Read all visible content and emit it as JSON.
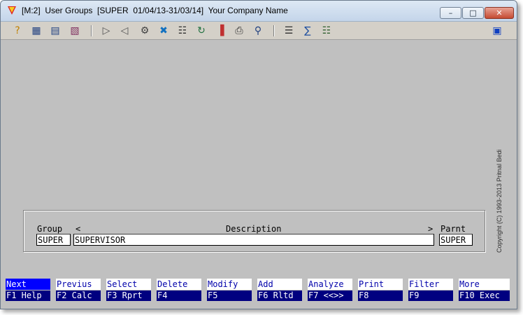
{
  "window": {
    "title": "[M:2]  User Groups  [SUPER  01/04/13-31/03/14]  Your Company Name",
    "buttons": {
      "minimize": "–",
      "maximize": "□",
      "close": "✕"
    }
  },
  "toolbar": {
    "icons": [
      {
        "name": "help-icon",
        "glyph": "?"
      },
      {
        "name": "grid-icon",
        "glyph": "▦"
      },
      {
        "name": "table-icon",
        "glyph": "▤"
      },
      {
        "name": "chart-icon",
        "glyph": "▧"
      },
      {
        "name": "play-next-icon",
        "glyph": "▷"
      },
      {
        "name": "play-prev-icon",
        "glyph": "◁"
      },
      {
        "name": "settings-icon",
        "glyph": "⚙"
      },
      {
        "name": "tools-icon",
        "glyph": "✖"
      },
      {
        "name": "document-icon",
        "glyph": "☷"
      },
      {
        "name": "sync-icon",
        "glyph": "↻"
      },
      {
        "name": "bar-chart-icon",
        "glyph": "▐"
      },
      {
        "name": "printer-icon",
        "glyph": "⎙"
      },
      {
        "name": "search-icon",
        "glyph": "⚲"
      },
      {
        "name": "clipboard-icon",
        "glyph": "☰"
      },
      {
        "name": "calculator-icon",
        "glyph": "∑"
      },
      {
        "name": "network-icon",
        "glyph": "☷"
      },
      {
        "name": "exit-icon",
        "glyph": "▣"
      }
    ]
  },
  "copyright": "Copyright (C) 1993-2013 Pritnal Bedi",
  "form": {
    "headers": {
      "group": "Group",
      "lt": "<",
      "description": "Description",
      "gt": ">",
      "parent": "Parnt"
    },
    "values": {
      "group": "SUPER",
      "description": "SUPERVISOR",
      "parent": "SUPER"
    }
  },
  "fkeys": [
    {
      "top": "Next",
      "bottom": "F1 Help"
    },
    {
      "top": "Previus",
      "bottom": "F2 Calc"
    },
    {
      "top": "Select",
      "bottom": "F3 Rprt"
    },
    {
      "top": "Delete",
      "bottom": "F4"
    },
    {
      "top": "Modify",
      "bottom": "F5"
    },
    {
      "top": "Add",
      "bottom": "F6 Rltd"
    },
    {
      "top": "Analyze",
      "bottom": "F7 <<>>"
    },
    {
      "top": "Print",
      "bottom": "F8"
    },
    {
      "top": "Filter",
      "bottom": "F9"
    },
    {
      "top": "More",
      "bottom": "F10 Exec"
    }
  ],
  "colors": {
    "background": "#c0c0c0",
    "fkey_bottom": "#000080",
    "fkey_active": "#0000ff",
    "fkey_text": "#0000aa"
  }
}
